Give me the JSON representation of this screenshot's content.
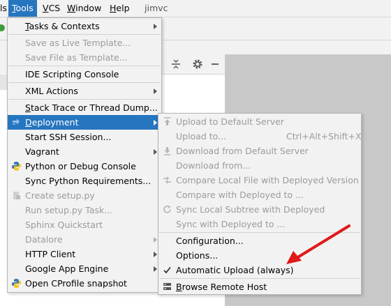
{
  "menubar": {
    "items": [
      {
        "label": "ools",
        "mnemonic": "T",
        "selected": true
      },
      {
        "label": "CS",
        "mnemonic": "V"
      },
      {
        "label": "indow",
        "mnemonic": "W"
      },
      {
        "label": "elp",
        "mnemonic": "H"
      }
    ],
    "partial_left": "ls",
    "project": "jimvc"
  },
  "tools_menu": {
    "items": [
      {
        "label": "asks & Contexts",
        "mnemonic": "T",
        "submenu": true
      },
      {
        "label": "Save as Live Template...",
        "disabled": true
      },
      {
        "label": "Save File as Template...",
        "disabled": true
      },
      {
        "label": "IDE Scripting Console"
      },
      {
        "label": "XML Actions",
        "submenu": true
      },
      {
        "label": "tack Trace or Thread Dump...",
        "mnemonic": "S"
      },
      {
        "label": "eployment",
        "mnemonic": "D",
        "submenu": true,
        "selected": true
      },
      {
        "label": "Start SSH Session..."
      },
      {
        "label": "Vagrant",
        "submenu": true
      },
      {
        "label": "Python or Debug Console"
      },
      {
        "label": "Sync Python Requirements..."
      },
      {
        "label": "Create setup.py",
        "disabled": true
      },
      {
        "label": "Run setup.py Task...",
        "disabled": true
      },
      {
        "label": "Sphinx Quickstart",
        "disabled": true
      },
      {
        "label": "Datalore",
        "disabled": true,
        "submenu": true
      },
      {
        "label": "HTTP Client",
        "submenu": true
      },
      {
        "label": "Google App Engine",
        "submenu": true
      },
      {
        "label": "Open CProfile snapshot"
      }
    ]
  },
  "deployment_menu": {
    "items": [
      {
        "label": "Upload to Default Server",
        "disabled": true,
        "icon": "upload-arrow-icon"
      },
      {
        "label": "Upload to...",
        "disabled": true,
        "shortcut": "Ctrl+Alt+Shift+X"
      },
      {
        "label": "Download from Default Server",
        "disabled": true,
        "icon": "download-arrow-icon"
      },
      {
        "label": "Download from...",
        "disabled": true
      },
      {
        "label": "Compare Local File with Deployed Version",
        "disabled": true,
        "icon": "compare-icon"
      },
      {
        "label": "Compare with Deployed to ...",
        "disabled": true
      },
      {
        "label": "Sync Local Subtree with Deployed",
        "disabled": true,
        "icon": "sync-icon"
      },
      {
        "label": "Sync with Deployed to ...",
        "disabled": true
      },
      {
        "label": "Configuration..."
      },
      {
        "label": "Options..."
      },
      {
        "label": "Automatic Upload (always)",
        "checked": true
      },
      {
        "label": "rowse Remote Host",
        "mnemonic": "B",
        "icon": "remote-host-icon"
      }
    ]
  },
  "colors": {
    "selection": "#2675bf",
    "menu_bg": "#f2f2f2",
    "disabled_text": "#9b9b9b",
    "annotation": "#e0191b"
  }
}
